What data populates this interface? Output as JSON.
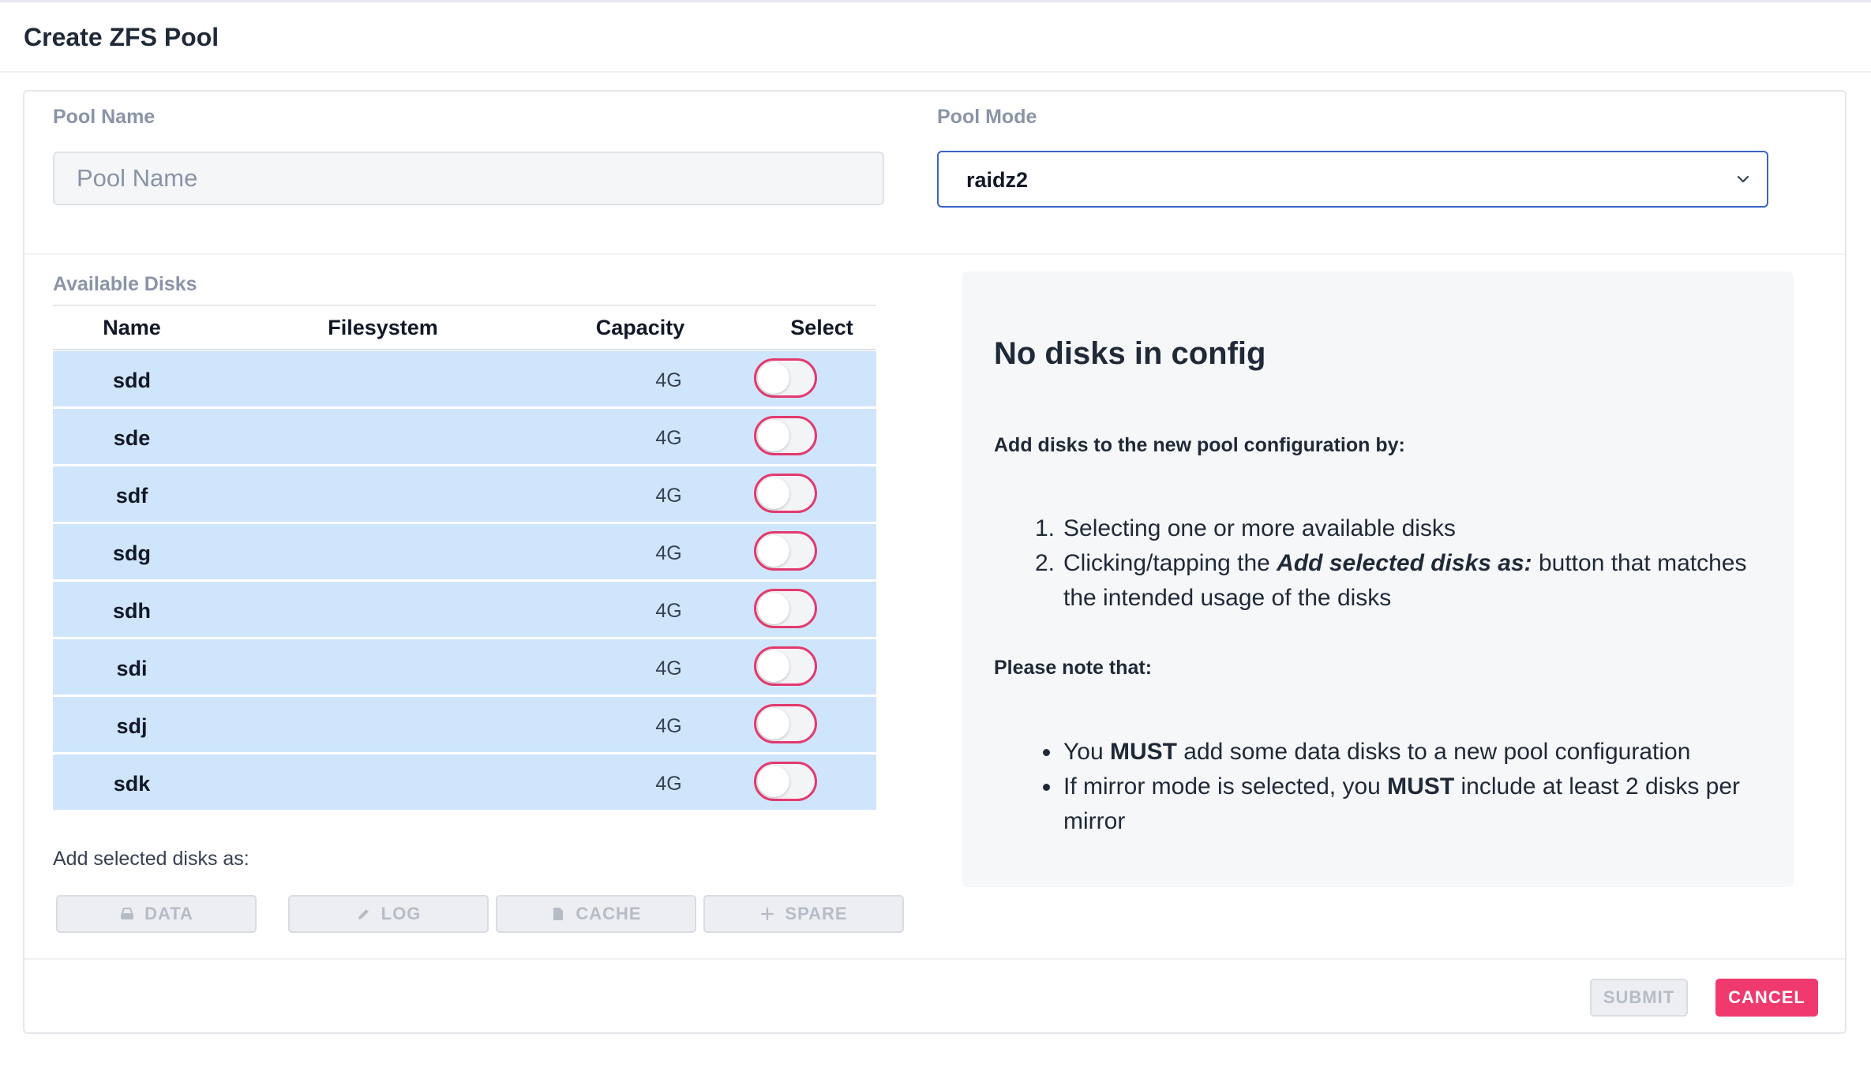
{
  "dialog": {
    "title": "Create ZFS Pool"
  },
  "pool_name": {
    "label": "Pool Name",
    "value": "",
    "placeholder": "Pool Name"
  },
  "pool_mode": {
    "label": "Pool Mode",
    "selected": "raidz2"
  },
  "available_disks": {
    "label": "Available Disks",
    "columns": [
      "Name",
      "Filesystem",
      "Capacity",
      "Select"
    ],
    "rows": [
      {
        "name": "sdd",
        "filesystem": "",
        "capacity": "4G",
        "selected": false
      },
      {
        "name": "sde",
        "filesystem": "",
        "capacity": "4G",
        "selected": false
      },
      {
        "name": "sdf",
        "filesystem": "",
        "capacity": "4G",
        "selected": false
      },
      {
        "name": "sdg",
        "filesystem": "",
        "capacity": "4G",
        "selected": false
      },
      {
        "name": "sdh",
        "filesystem": "",
        "capacity": "4G",
        "selected": false
      },
      {
        "name": "sdi",
        "filesystem": "",
        "capacity": "4G",
        "selected": false
      },
      {
        "name": "sdj",
        "filesystem": "",
        "capacity": "4G",
        "selected": false
      },
      {
        "name": "sdk",
        "filesystem": "",
        "capacity": "4G",
        "selected": false
      }
    ]
  },
  "add_selected": {
    "label": "Add selected disks as:",
    "buttons": [
      {
        "label": "DATA",
        "icon": "hard-drive-icon",
        "enabled": false
      },
      {
        "label": "LOG",
        "icon": "pencil-icon",
        "enabled": false
      },
      {
        "label": "CACHE",
        "icon": "file-icon",
        "enabled": false
      },
      {
        "label": "SPARE",
        "icon": "plus-icon",
        "enabled": false
      }
    ]
  },
  "info": {
    "title": "No disks in config",
    "subtitle": "Add disks to the new pool configuration by:",
    "steps": [
      {
        "number": "1.",
        "text": "Selecting one or more available disks"
      },
      {
        "number": "2.",
        "pre": "Clicking/tapping the ",
        "emphasis": "Add selected disks as:",
        "post": " button that matches the intended usage of the disks"
      }
    ],
    "note_heading": "Please note that:",
    "notes": [
      {
        "pre": "You ",
        "strong": "MUST",
        "post": " add some data disks to a new pool configuration"
      },
      {
        "pre": "If mirror mode is selected, you ",
        "strong": "MUST",
        "post": " include at least 2 disks per mirror"
      }
    ]
  },
  "footer": {
    "submit_label": "SUBMIT",
    "cancel_label": "CANCEL"
  },
  "colors": {
    "accent": "#f0396e",
    "row_highlight": "#cfe5fb",
    "focus_border": "#3b63c8"
  }
}
